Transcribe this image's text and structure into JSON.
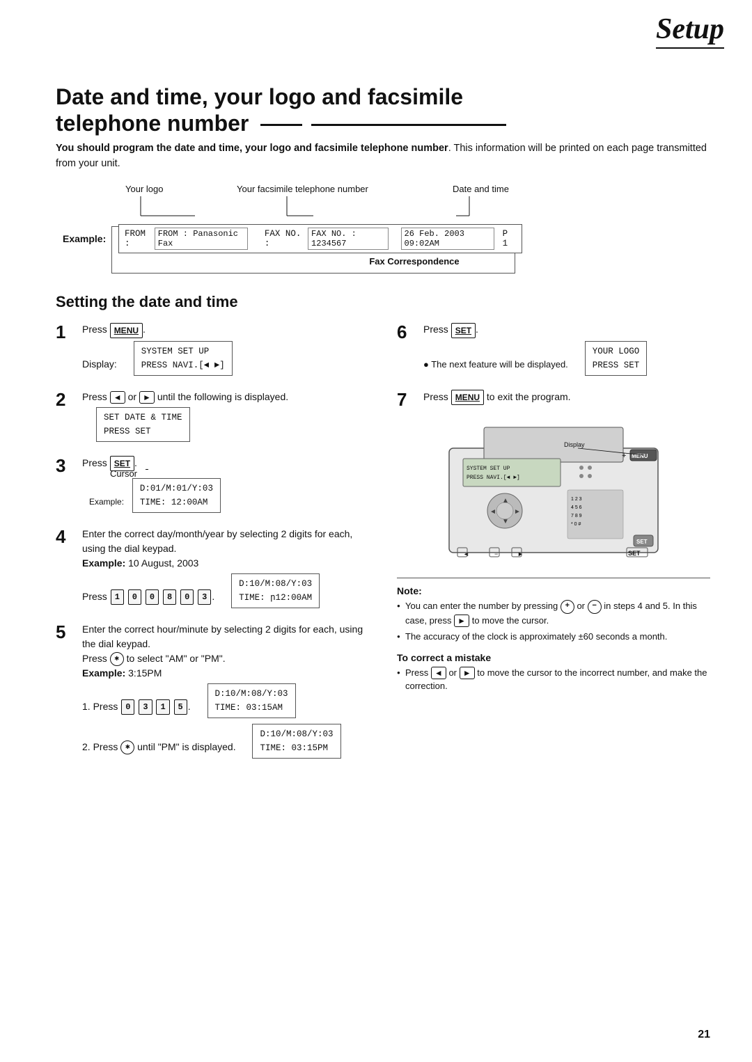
{
  "header": {
    "title": "Setup"
  },
  "page": {
    "section_title_line1": "Date and time, your logo and facsimile",
    "section_title_line2": "telephone number",
    "intro": {
      "bold_part": "You should program the date and time, your logo and facsimile telephone number",
      "normal_part": ". This information will be printed on each page transmitted from your unit."
    },
    "example_labels": {
      "logo": "Your logo",
      "fax_number": "Your facsimile telephone number",
      "date_time": "Date and time"
    },
    "example": {
      "label": "Example:",
      "from": "FROM : Panasonic Fax",
      "fax_no": "FAX NO. : 1234567",
      "date": "26 Feb. 2003 09:02AM",
      "page": "P 1"
    },
    "fax_correspondence": "Fax Correspondence"
  },
  "setting_section": {
    "title": "Setting the date and time"
  },
  "steps": {
    "step1": {
      "num": "1",
      "text": "Press",
      "key": "MENU",
      "display_label": "Display:",
      "display_line1": "SYSTEM SET UP",
      "display_line2": "PRESS NAVI.[◄ ►]"
    },
    "step2": {
      "num": "2",
      "text_before": "Press",
      "arrow_left": "◄",
      "text_mid": "or",
      "arrow_right": "►",
      "text_after": "until the following is displayed.",
      "display_line1": "SET DATE & TIME",
      "display_line2": "PRESS SET"
    },
    "step3": {
      "num": "3",
      "text": "Press",
      "key": "SET",
      "cursor_label": "Cursor",
      "example_label": "Example:",
      "display_line1": "D:01/M:01/Y:03",
      "display_line2": "TIME: 12:00AM"
    },
    "step4": {
      "num": "4",
      "text1": "Enter the correct day/month/year by selecting 2 digits for each, using the dial keypad.",
      "example_label": "Example:",
      "example_text": "10 August, 2003",
      "press_text": "Press",
      "keys": [
        "1",
        "0",
        "0",
        "8",
        "0",
        "3"
      ],
      "display_line1": "D:10/M:08/Y:03",
      "display_line2": "TIME: ր12:00AM"
    },
    "step5": {
      "num": "5",
      "text1": "Enter the correct hour/minute by selecting 2 digits for each, using the dial keypad.",
      "text2": "Press",
      "star_key": "*",
      "text3": "to select \"AM\" or \"PM\".",
      "example_label": "Example:",
      "example_text": "3:15PM",
      "press1_text": "1. Press",
      "keys1": [
        "0",
        "3",
        "1",
        "5"
      ],
      "display1_line1": "D:10/M:08/Y:03",
      "display1_line2": "TIME: 03:15AM",
      "press2_text": "2. Press",
      "star2_key": "*",
      "text4": "until \"PM\" is displayed.",
      "display2_line1": "D:10/M:08/Y:03",
      "display2_line2": "TIME: 03:15PM"
    },
    "step6": {
      "num": "6",
      "text": "Press",
      "key": "SET",
      "bullet_text": "The next feature will be displayed.",
      "display_line1": "YOUR LOGO",
      "display_line2": "PRESS SET"
    },
    "step7": {
      "num": "7",
      "text": "Press",
      "key": "MENU",
      "text2": "to exit the program."
    }
  },
  "note": {
    "title": "Note:",
    "items": [
      "You can enter the number by pressing",
      "in steps 4 and 5. In this case, press",
      "to move the cursor.",
      "The accuracy of the clock is approximately ±60 seconds a month."
    ],
    "plus_key": "+",
    "minus_key": "−",
    "arrow_key": "►"
  },
  "correct": {
    "title": "To correct a mistake",
    "text": "Press",
    "arrow_left": "◄",
    "or": "or",
    "arrow_right": "►",
    "text2": "to move the cursor to the incorrect number, and make the correction."
  },
  "page_number": "21"
}
